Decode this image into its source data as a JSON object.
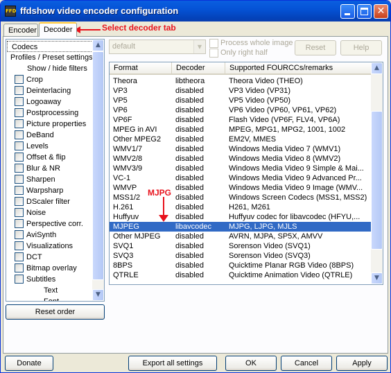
{
  "window": {
    "title": "ffdshow video encoder configuration",
    "icon_text": "FFD"
  },
  "tabs": [
    {
      "label": "Encoder"
    },
    {
      "label": "Decoder",
      "selected": true
    }
  ],
  "annotations": {
    "tab_note": "Select decoder tab",
    "row_note": "MJPG",
    "color": "#e8121c"
  },
  "sidebar": {
    "items": [
      {
        "label": "Codecs",
        "selected": true,
        "checkbox": false,
        "indent": 0
      },
      {
        "label": "Profiles / Preset settings",
        "checkbox": false,
        "indent": 0
      },
      {
        "label": "Show / hide filters",
        "checkbox": false,
        "indent": 2
      },
      {
        "label": "Crop",
        "checkbox": true
      },
      {
        "label": "Deinterlacing",
        "checkbox": true
      },
      {
        "label": "Logoaway",
        "checkbox": true
      },
      {
        "label": "Postprocessing",
        "checkbox": true
      },
      {
        "label": "Picture properties",
        "checkbox": true
      },
      {
        "label": "DeBand",
        "checkbox": true
      },
      {
        "label": "Levels",
        "checkbox": true
      },
      {
        "label": "Offset & flip",
        "checkbox": true
      },
      {
        "label": "Blur & NR",
        "checkbox": true
      },
      {
        "label": "Sharpen",
        "checkbox": true
      },
      {
        "label": "Warpsharp",
        "checkbox": true
      },
      {
        "label": "DScaler filter",
        "checkbox": true
      },
      {
        "label": "Noise",
        "checkbox": true
      },
      {
        "label": "Perspective corr.",
        "checkbox": true
      },
      {
        "label": "AviSynth",
        "checkbox": true
      },
      {
        "label": "Visualizations",
        "checkbox": true
      },
      {
        "label": "DCT",
        "checkbox": true
      },
      {
        "label": "Bitmap overlay",
        "checkbox": true
      },
      {
        "label": "Subtitles",
        "checkbox": true
      },
      {
        "label": "Text",
        "checkbox": false,
        "indent": 3
      },
      {
        "label": "Font",
        "checkbox": false,
        "indent": 3
      }
    ],
    "reset_order_label": "Reset order"
  },
  "preset": {
    "combo_value": "default",
    "process_whole_image_label": "Process whole image",
    "only_right_half_label": "Only right half",
    "reset_label": "Reset",
    "help_label": "Help"
  },
  "codec_table": {
    "headers": [
      "Format",
      "Decoder",
      "Supported FOURCCs/remarks"
    ],
    "rows": [
      [
        "Theora",
        "libtheora",
        "Theora Video (THEO)"
      ],
      [
        "VP3",
        "disabled",
        "VP3 Video (VP31)"
      ],
      [
        "VP5",
        "disabled",
        "VP5 Video (VP50)"
      ],
      [
        "VP6",
        "disabled",
        "VP6 Video (VP60, VP61, VP62)"
      ],
      [
        "VP6F",
        "disabled",
        "Flash Video (VP6F, FLV4, VP6A)"
      ],
      [
        "MPEG in AVI",
        "disabled",
        "MPEG, MPG1, MPG2, 1001, 1002"
      ],
      [
        "Other MPEG2",
        "disabled",
        "EM2V, MMES"
      ],
      [
        "WMV1/7",
        "disabled",
        "Windows Media Video 7 (WMV1)"
      ],
      [
        "WMV2/8",
        "disabled",
        "Windows Media Video 8 (WMV2)"
      ],
      [
        "WMV3/9",
        "disabled",
        "Windows Media Video 9 Simple & Mai..."
      ],
      [
        "VC-1",
        "disabled",
        "Windows Media Video 9 Advanced Pr..."
      ],
      [
        "WMVP",
        "disabled",
        "Windows Media Video 9 Image (WMV..."
      ],
      [
        "MSS1/2",
        "disabled",
        "Windows Screen Codecs (MSS1, MSS2)"
      ],
      [
        "H.261",
        "disabled",
        "H261, M261"
      ],
      [
        "Huffyuv",
        "disabled",
        "Huffyuv codec for libavcodec (HFYU,..."
      ],
      [
        "MJPEG",
        "libavcodec",
        "MJPG, LJPG, MJLS"
      ],
      [
        "Other MJPEG",
        "disabled",
        "AVRN, MJPA, SP5X, AMVV"
      ],
      [
        "SVQ1",
        "disabled",
        "Sorenson Video (SVQ1)"
      ],
      [
        "SVQ3",
        "disabled",
        "Sorenson Video (SVQ3)"
      ],
      [
        "8BPS",
        "disabled",
        "Quicktime Planar RGB Video (8BPS)"
      ],
      [
        "QTRLE",
        "disabled",
        "Quicktime Animation Video (QTRLE)"
      ]
    ],
    "selected_row": 15
  },
  "footer": {
    "donate_label": "Donate",
    "export_label": "Export all settings",
    "ok_label": "OK",
    "cancel_label": "Cancel",
    "apply_label": "Apply"
  },
  "icons": {
    "minimize": "minimize-icon",
    "maximize": "maximize-icon",
    "close": "close-icon",
    "scroll_up": "scroll-up-icon",
    "scroll_down": "scroll-down-icon",
    "dropdown": "chevron-down-icon"
  }
}
